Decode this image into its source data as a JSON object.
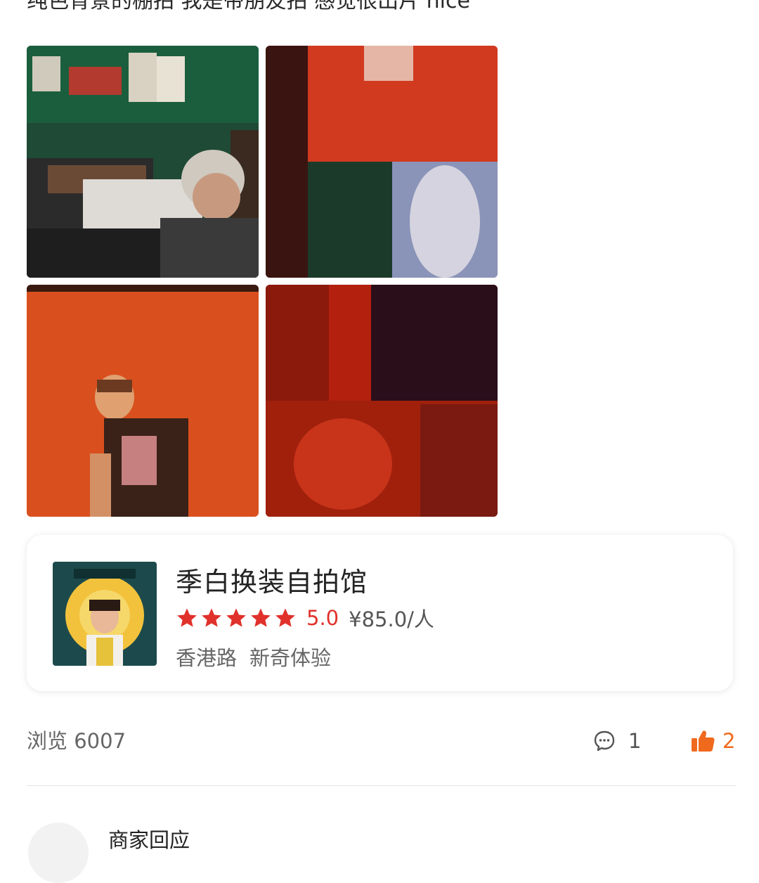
{
  "review": {
    "text": "纯色背景的棚拍 我是带朋友拍 感觉很出片 nice"
  },
  "photos": [
    {
      "alt": "photo-1"
    },
    {
      "alt": "photo-2"
    },
    {
      "alt": "photo-3"
    },
    {
      "alt": "photo-4"
    }
  ],
  "shop": {
    "name": "季白换装自拍馆",
    "rating_value": 5.0,
    "rating_text": "5.0",
    "price": "¥85.0/人",
    "area": "香港路",
    "category": "新奇体验",
    "star_color": "#e0312b"
  },
  "stats": {
    "views_label": "浏览 6007",
    "comments_count": "1",
    "likes_count": "2",
    "like_color": "#f06a1e"
  },
  "merchant": {
    "reply_label": "商家回应"
  }
}
